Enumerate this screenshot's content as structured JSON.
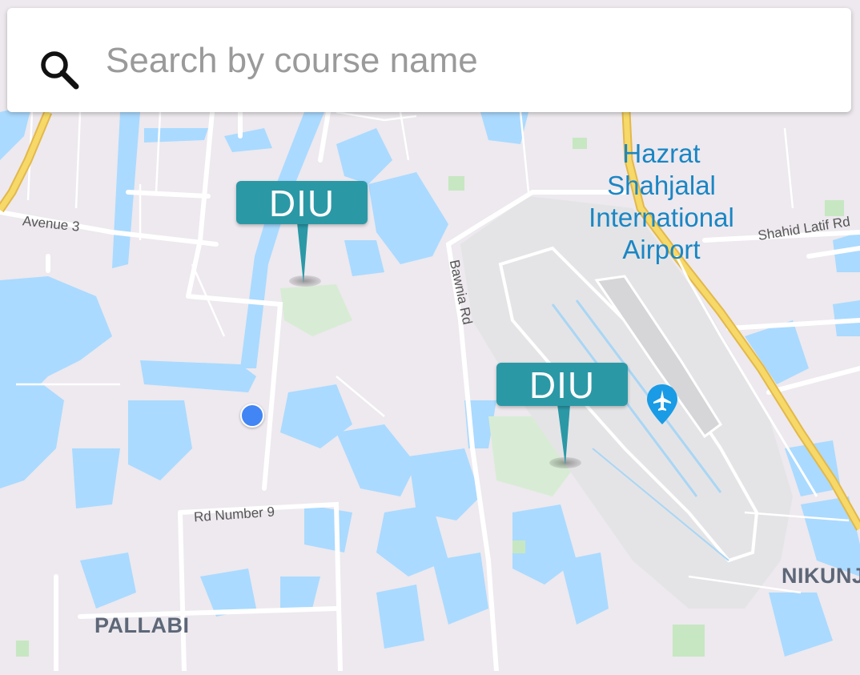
{
  "search": {
    "placeholder": "Search by course name",
    "icon": "search-icon"
  },
  "map": {
    "colors": {
      "land": "#ede9ee",
      "water": "#aadaff",
      "airport_area": "#e6e6e6",
      "park": "#d8ecd5",
      "road": "#ffffff",
      "highway": "#f6d968",
      "highway_edge": "#e3b84a",
      "marker": "#2b98a6",
      "poi_blue": "#1a86c4",
      "my_location": "#4285f4"
    },
    "labels": {
      "avenue_3": "Avenue 3",
      "bawnia_rd": "Bawnia Rd",
      "rd_number_9": "Rd Number 9",
      "shahid_latif": "Shahid Latif Rd",
      "pallabi": "PALLABI",
      "nikunja": "NIKUNJ",
      "airport": [
        "Hazrat",
        "Shahjalal",
        "International",
        "Airport"
      ]
    },
    "markers": [
      {
        "label": "DIU"
      },
      {
        "label": "DIU"
      }
    ],
    "airport_icon": "airplane-icon"
  }
}
